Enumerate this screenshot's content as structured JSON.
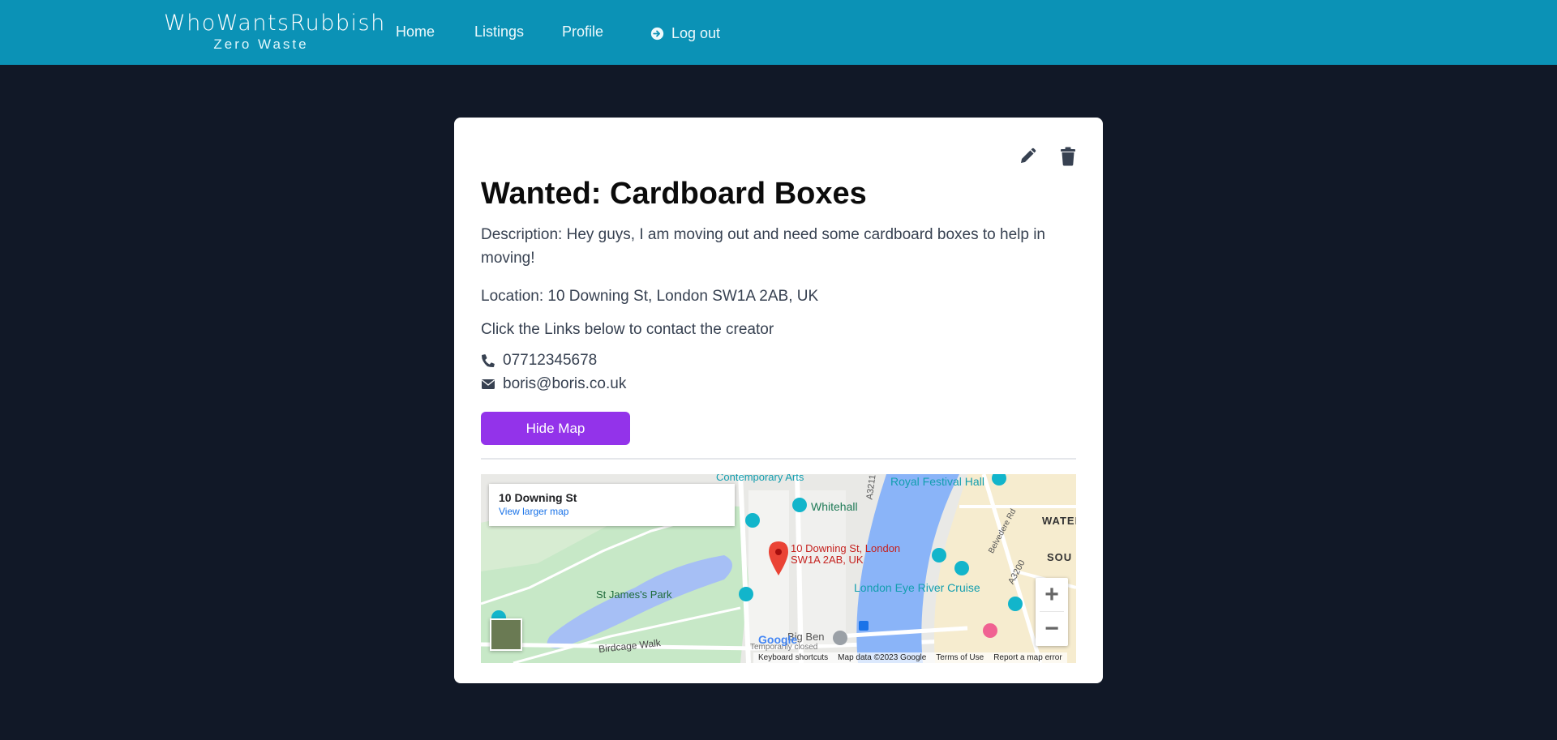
{
  "navbar": {
    "brand_title": "WhoWantsRubbish",
    "brand_subtitle": "Zero Waste",
    "links": {
      "home": "Home",
      "listings": "Listings",
      "profile": "Profile",
      "logout": "Log out"
    },
    "background": "#0b92b6"
  },
  "listing": {
    "title": "Wanted: Cardboard Boxes",
    "description": "Description: Hey guys, I am moving out and need some cardboard boxes to help in moving!",
    "location": "Location: 10 Downing St, London SW1A 2AB, UK",
    "contact_hint": "Click the Links below to contact the creator",
    "phone": "07712345678",
    "email": "boris@boris.co.uk",
    "hide_map_label": "Hide Map",
    "accent": "#9333ea"
  },
  "map": {
    "info_title": "10 Downing St",
    "info_link": "View larger map",
    "marker_label_line1": "10 Downing St, London",
    "marker_label_line2": "SW1A 2AB, UK",
    "labels": {
      "contemporary_arts": "Contemporary Arts",
      "whitehall": "Whitehall",
      "royal_festival_hall": "Royal Festival Hall",
      "waterloo": "WATERL",
      "south": "SOU",
      "st_james_park": "St James's Park",
      "london_eye": "London Eye River Cruise",
      "big_ben": "Big Ben",
      "temporarily_closed": "Temporarily closed",
      "birdcage_walk": "Birdcage Walk",
      "a3211": "A3211",
      "a3200": "A3200",
      "belvedere": "Belvedere Rd",
      "google": "Google"
    },
    "zoom_in": "+",
    "zoom_out": "−",
    "footer": {
      "shortcuts": "Keyboard shortcuts",
      "data": "Map data ©2023 Google",
      "terms": "Terms of Use",
      "report": "Report a map error"
    }
  }
}
